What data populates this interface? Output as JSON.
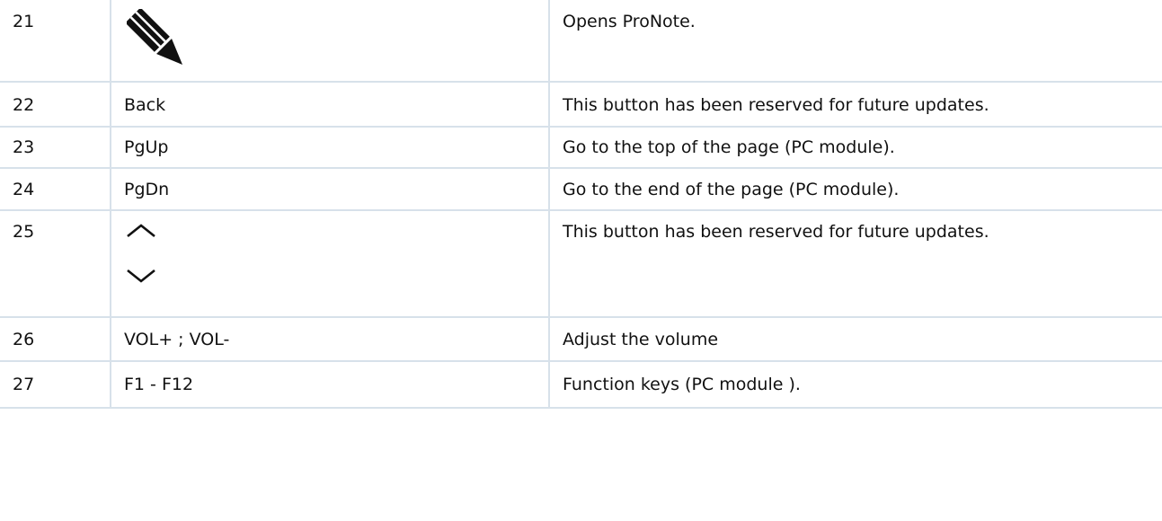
{
  "rows": [
    {
      "num": "21",
      "key": "",
      "key_icon": "pencil-icon",
      "desc": "Opens ProNote."
    },
    {
      "num": "22",
      "key": "Back",
      "desc": "This button has been reserved for future updates."
    },
    {
      "num": "23",
      "key": "PgUp",
      "desc": "Go to the top of the page (PC module)."
    },
    {
      "num": "24",
      "key": "PgDn",
      "desc": "Go to the end of the page (PC module)."
    },
    {
      "num": "25",
      "key": "",
      "key_icons": [
        "chevron-up-icon",
        "chevron-down-icon"
      ],
      "desc": "This button has been reserved for future updates."
    },
    {
      "num": "26",
      "key": "VOL+ ; VOL-",
      "desc": "Adjust the volume"
    },
    {
      "num": "27",
      "key": "F1 - F12",
      "desc": "Function keys (PC module )."
    }
  ]
}
